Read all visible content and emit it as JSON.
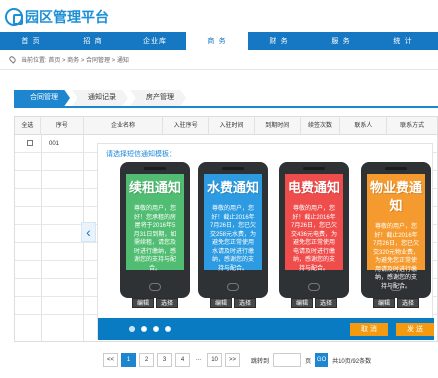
{
  "app": {
    "title": "园区管理平台"
  },
  "nav": [
    "首 页",
    "招 商",
    "企业库",
    "商 务",
    "财 务",
    "服 务",
    "统 计"
  ],
  "breadcrumb": "当前位置: 首页 > 商务 > 合同管理 > 通知",
  "tabs": [
    "合同管理",
    "通知记录",
    "房产管理"
  ],
  "table": {
    "headers": [
      "全选",
      "序号",
      "企业名称",
      "入驻序号",
      "入驻时间",
      "到期时间",
      "续签次数",
      "联系人",
      "联系方式"
    ],
    "rows": [
      {
        "number": "001"
      }
    ]
  },
  "modal": {
    "title": "请选择短信通知模板：",
    "templates": [
      {
        "title": "续租通知",
        "color": "#51bd72",
        "body": "尊敬的用户，您好！您承租的房屋将于2016年5月31日到期，如需续租，请您及时进行缴纳，感谢您的支持与配合。",
        "edit": "编辑",
        "choose": "选择"
      },
      {
        "title": "水费通知",
        "color": "#2d9be1",
        "body": "尊敬的用户，您好！截止2016年7月26日，您已欠交258元水费，为避免您正常使用水请及时进行缴纳，感谢您的支持与配合。",
        "edit": "编辑",
        "choose": "选择"
      },
      {
        "title": "电费通知",
        "color": "#ef4d4b",
        "body": "尊敬的用户，您好！截止2016年7月26日，您已欠交436元电费，为避免您正常使用电请及时进行缴纳，感谢您的支持与配合。",
        "edit": "编辑",
        "choose": "选择"
      },
      {
        "title": "物业费通知",
        "color": "#f49a2e",
        "body": "尊敬的用户，您好！截止2016年7月26日，您已欠交320元物业费，为避免您正常使用请及时进行缴纳，感谢您的支持与配合。",
        "edit": "编辑",
        "choose": "选择"
      }
    ],
    "cancel": "取 消",
    "confirm": "发 送"
  },
  "pagination": {
    "prev": "<<",
    "pages": [
      "1",
      "2",
      "3",
      "4"
    ],
    "ellipsis": "...",
    "last": "10",
    "next": ">>",
    "jump_label": "跳转到",
    "page_suffix": "页",
    "go": "GO",
    "summary": "共10页/92条数"
  },
  "colors": {
    "primary": "#1d86cf",
    "nav": "#1677c2",
    "accent": "#f39a11"
  }
}
